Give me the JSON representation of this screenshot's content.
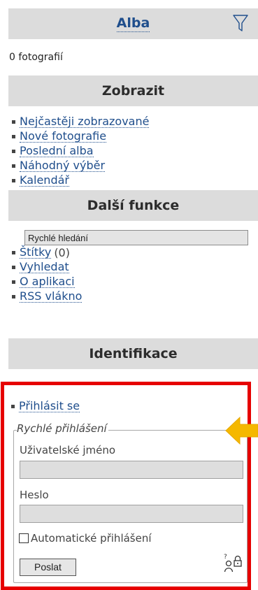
{
  "albums": {
    "title": "Alba",
    "photo_count": "0 fotografií",
    "filter_icon": "filter-funnel-icon"
  },
  "view": {
    "title": "Zobrazit",
    "items": [
      "Nejčastěji zobrazované",
      "Nové fotografie",
      "Poslední alba",
      "Náhodný výběr",
      "Kalendář"
    ]
  },
  "more": {
    "title": "Další funkce",
    "quick_search_value": "Rychlé hledání",
    "tags_label": "Štítky",
    "tags_count": "(0)",
    "items": [
      "Vyhledat",
      "O aplikaci",
      "RSS vlákno"
    ]
  },
  "identification": {
    "title": "Identifikace",
    "login_link": "Přihlásit se",
    "quick_login_legend": "Rychlé přihlášení",
    "username_label": "Uživatelské jméno",
    "password_label": "Heslo",
    "auto_login_label": "Automatické přihlášení",
    "submit_label": "Poslat",
    "highlight_color": "#e60000",
    "arrow_color": "#f5b800"
  }
}
